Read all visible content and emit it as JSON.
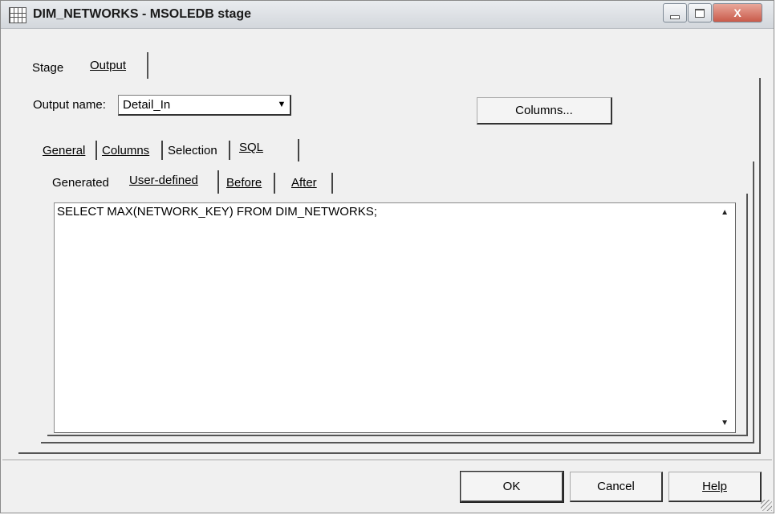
{
  "window": {
    "title": "DIM_NETWORKS - MSOLEDB stage",
    "controls": {
      "minimize": "",
      "maximize": "",
      "close": "X"
    }
  },
  "outer_tabs": {
    "stage": {
      "label": "Stage",
      "mnemonic": "a"
    },
    "output": {
      "label": "Output",
      "mnemonic": "O",
      "active": true
    }
  },
  "output_name": {
    "label": "Output name:",
    "value": "Detail_In"
  },
  "columns_button": {
    "label": "Columns..."
  },
  "mid_tabs": {
    "general": {
      "label": "General",
      "mnemonic": "G"
    },
    "columns": {
      "label": "Columns",
      "mnemonic": "C"
    },
    "selection": {
      "label": "Selection",
      "mnemonic": "e"
    },
    "sql": {
      "label": "SQL",
      "mnemonic": "Q",
      "active": true
    }
  },
  "inner_tabs": {
    "generated": {
      "label": "Generated",
      "mnemonic": "r"
    },
    "user_defined": {
      "label": "User-defined",
      "mnemonic": "U",
      "active": true
    },
    "before": {
      "label": "Before",
      "mnemonic": "B"
    },
    "after": {
      "label": "After",
      "mnemonic": "A"
    }
  },
  "sql_editor": {
    "text": "SELECT MAX(NETWORK_KEY) FROM DIM_NETWORKS;"
  },
  "buttons": {
    "ok": "OK",
    "cancel": "Cancel",
    "help": "Help"
  },
  "icons": {
    "scroll_up": "▲",
    "scroll_down": "▼",
    "combo_arrow": "▼"
  }
}
